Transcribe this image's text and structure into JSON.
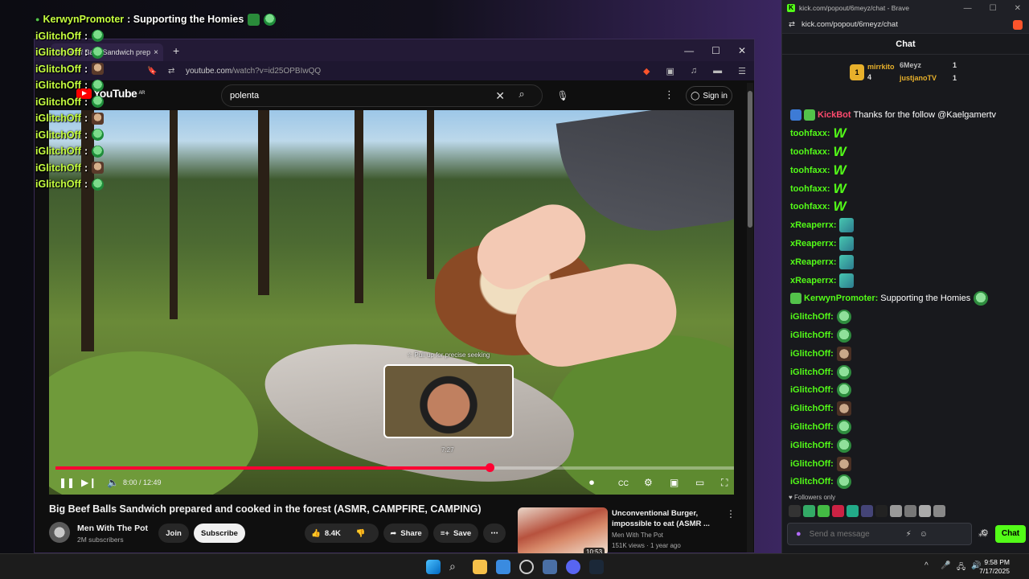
{
  "overlay_chat": [
    {
      "user": "KerwynPromoter",
      "text": ": Supporting the Homies",
      "emotes": [
        "em-cup",
        "em-green"
      ]
    },
    {
      "user": "iGlitchOff",
      "text": ":",
      "emotes": [
        "em-green"
      ]
    },
    {
      "user": "iGlitchOff",
      "text": ":",
      "emotes": [
        "em-green"
      ]
    },
    {
      "user": "iGlitchOff",
      "text": ":",
      "emotes": [
        "em-brown"
      ]
    },
    {
      "user": "iGlitchOff",
      "text": ":",
      "emotes": [
        "em-green"
      ]
    },
    {
      "user": "iGlitchOff",
      "text": ":",
      "emotes": [
        "em-green"
      ]
    },
    {
      "user": "iGlitchOff",
      "text": ":",
      "emotes": [
        "em-brown"
      ]
    },
    {
      "user": "iGlitchOff",
      "text": ":",
      "emotes": [
        "em-green"
      ]
    },
    {
      "user": "iGlitchOff",
      "text": ":",
      "emotes": [
        "em-green"
      ]
    },
    {
      "user": "iGlitchOff",
      "text": ":",
      "emotes": [
        "em-brown"
      ]
    },
    {
      "user": "iGlitchOff",
      "text": ":",
      "emotes": [
        "em-green"
      ]
    }
  ],
  "browser": {
    "tab_title": "Big Beef Balls Sandwich prep",
    "tab_close": "×",
    "tab_add": "+",
    "url_host": "youtube.com",
    "url_path": "/watch?v=id25OPBIwQQ",
    "win_min": "—",
    "win_max": "☐",
    "win_close": "✕"
  },
  "youtube": {
    "logo": "YouTube",
    "region": "AR",
    "search_value": "polenta",
    "signin": "Sign in",
    "seek_hint": "☆ Pull up for precise seeking",
    "seek_time": "7:27",
    "time": "8:00 / 12:49",
    "progress_fraction": 0.624,
    "hover_fraction": 0.582,
    "video_title": "Big Beef Balls Sandwich prepared and cooked in the forest (ASMR, CAMPFIRE, CAMPING)",
    "channel_name": "Men With The Pot",
    "channel_subs": "2M subscribers",
    "join": "Join",
    "subscribe": "Subscribe",
    "likes": "8.4K",
    "share": "Share",
    "save": "Save",
    "rec": {
      "title": "Unconventional Burger, impossible to eat (ASMR ...",
      "channel": "Men With The Pot",
      "meta": "151K views · 1 year ago",
      "duration": "10:53"
    }
  },
  "kick": {
    "window_url": "kick.com/popout/6meyz/chat - Brave",
    "address": "kick.com/popout/6meyz/chat",
    "header": "Chat",
    "leaderboard": [
      {
        "name": "mirrkito",
        "count": "4",
        "color": "#e7b02b"
      },
      {
        "name": "6Meyz",
        "count": "1",
        "color": "#bbbbbb"
      },
      {
        "name": "justjanoTV",
        "count": "1",
        "color": "#e7b02b"
      }
    ],
    "messages": [
      {
        "user": "KickBot",
        "color": "#ff4a6e",
        "text": "Thanks for the follow @Kaelgamertv",
        "emote": "",
        "badges": [
          "#3d7bd6",
          "#53c24a"
        ]
      },
      {
        "user": "toohfaxx:",
        "color": "#53fc18",
        "text": "",
        "emote": "W",
        "badges": []
      },
      {
        "user": "toohfaxx:",
        "color": "#53fc18",
        "text": "",
        "emote": "W",
        "badges": []
      },
      {
        "user": "toohfaxx:",
        "color": "#53fc18",
        "text": "",
        "emote": "W",
        "badges": []
      },
      {
        "user": "toohfaxx:",
        "color": "#53fc18",
        "text": "",
        "emote": "W",
        "badges": []
      },
      {
        "user": "toohfaxx:",
        "color": "#53fc18",
        "text": "",
        "emote": "W",
        "badges": []
      },
      {
        "user": "xReaperrx:",
        "color": "#53fc18",
        "text": "",
        "emote": "em-teal",
        "badges": []
      },
      {
        "user": "xReaperrx:",
        "color": "#53fc18",
        "text": "",
        "emote": "em-teal",
        "badges": []
      },
      {
        "user": "xReaperrx:",
        "color": "#53fc18",
        "text": "",
        "emote": "em-teal",
        "badges": []
      },
      {
        "user": "xReaperrx:",
        "color": "#53fc18",
        "text": "",
        "emote": "em-teal",
        "badges": []
      },
      {
        "user": "KerwynPromoter:",
        "color": "#53fc18",
        "text": "Supporting the Homies",
        "emote": "em-pepe",
        "badges": [
          "#53c24a"
        ]
      },
      {
        "user": "iGlitchOff:",
        "color": "#53fc18",
        "text": "",
        "emote": "em-pepe",
        "badges": []
      },
      {
        "user": "iGlitchOff:",
        "color": "#53fc18",
        "text": "",
        "emote": "em-pepe",
        "badges": []
      },
      {
        "user": "iGlitchOff:",
        "color": "#53fc18",
        "text": "",
        "emote": "em-cat",
        "badges": []
      },
      {
        "user": "iGlitchOff:",
        "color": "#53fc18",
        "text": "",
        "emote": "em-pepe",
        "badges": []
      },
      {
        "user": "iGlitchOff:",
        "color": "#53fc18",
        "text": "",
        "emote": "em-pepe",
        "badges": []
      },
      {
        "user": "iGlitchOff:",
        "color": "#53fc18",
        "text": "",
        "emote": "em-cat",
        "badges": []
      },
      {
        "user": "iGlitchOff:",
        "color": "#53fc18",
        "text": "",
        "emote": "em-pepe",
        "badges": []
      },
      {
        "user": "iGlitchOff:",
        "color": "#53fc18",
        "text": "",
        "emote": "em-pepe",
        "badges": []
      },
      {
        "user": "iGlitchOff:",
        "color": "#53fc18",
        "text": "",
        "emote": "em-cat",
        "badges": []
      },
      {
        "user": "iGlitchOff:",
        "color": "#53fc18",
        "text": "",
        "emote": "em-pepe",
        "badges": []
      }
    ],
    "followers_only": "Followers only",
    "input_placeholder": "Send a message",
    "send": "Chat"
  },
  "taskbar": {
    "time": "9:58 PM",
    "date": "7/17/2025"
  }
}
